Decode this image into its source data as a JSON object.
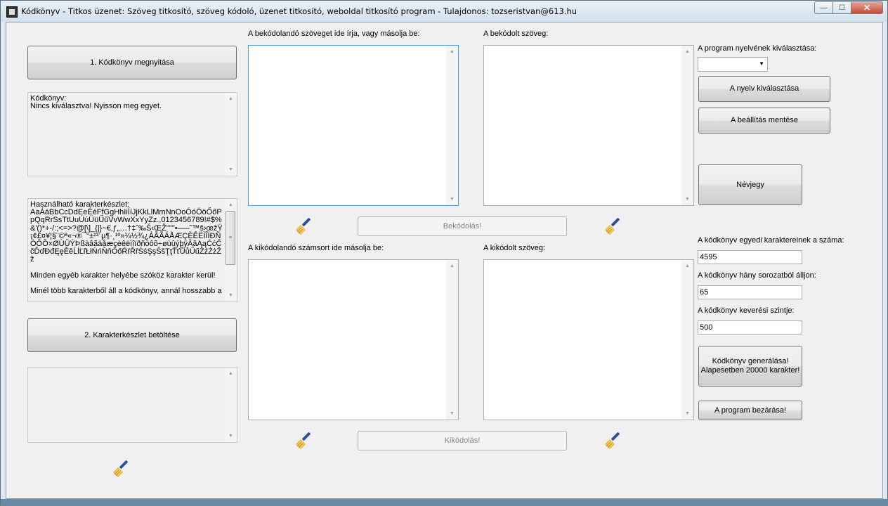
{
  "window": {
    "title": "Kódkönyv - Titkos üzenet: Szöveg titkosító, szöveg kódoló, üzenet titkosító, weboldal titkosító program - Tulajdonos: tozseristvan@613.hu",
    "min_label": "—",
    "max_label": "☐",
    "close_label": "✕"
  },
  "left": {
    "open_button": "1. Kódkönyv megnyitása",
    "codebook_info": "Kódkönyv:\nNincs kiválasztva! Nyisson meg egyet.",
    "charset_info": "Használható karakterkészlet:\nAaÁáBbCcDdEeÉéFfGgHhIiÍíJjKkLlMmNnOoÓóÖöŐőPpQqRrSsTtUuÚúÜüŰűVvWwXxYyZz.,0123456789!#$%&'()*+-/:;<=>?@[\\]_{|}~€‚ƒ„…†‡ˆ‰Š‹ŒŽ''\"\"•–—˜™š›œžŸ¡¢£¤¥¦§¨©ª«¬®¯°±²³´µ¶·¸¹º»¼½¾¿ÀÂÃÄÅÆÇÈÊËÌÎÏÐÑÒÔÕ×ØÙÛÝÞßàâãäåæçèêëìîïðñòôõ÷øùûýþÿĂăĄąĆćČčĎďĐđĘęĚěĹĺĽľŁłŃńŇňŐőŔŕŘřŚśŞşŠšŢţŤťŮůŰűŹźŻżŽž\n\nMinden egyéb karakter helyébe szóköz karakter kerül!\n\nMinél több karakterből áll a kódkönyv, annál hosszabb a",
    "charset_button": "2. Karakterkészlet betöltése",
    "bottom_box": ""
  },
  "encode": {
    "input_label": "A bekódolandó szöveget ide írja, vagy másolja be:",
    "output_label": "A bekódolt szöveg:",
    "input_value": "",
    "output_value": "",
    "button": "Bekódolás!"
  },
  "decode": {
    "input_label": "A kikódolandó számsort ide másolja be:",
    "output_label": "A kikódolt szöveg:",
    "input_value": "",
    "output_value": "",
    "button": "Kikódolás!"
  },
  "right": {
    "language_label": "A program nyelvének kiválasztása:",
    "language_value": "",
    "select_language_button": "A nyelv kiválasztása",
    "save_settings_button": "A beállítás mentése",
    "card_button": "Névjegy",
    "unique_chars_label": "A kódkönyv egyedi karaktereinek a száma:",
    "unique_chars_value": "4595",
    "series_label": "A kódkönyv hány sorozatból álljon:",
    "series_value": "65",
    "shuffle_label": "A kódkönyv keverési szintje:",
    "shuffle_value": "500",
    "generate_button_line1": "Kódkönyv generálása!",
    "generate_button_line2": "Alapesetben 20000 karakter!",
    "close_button": "A program bezárása!"
  },
  "icons": {
    "broom": "broom-icon",
    "app": "codebook-app-icon"
  }
}
